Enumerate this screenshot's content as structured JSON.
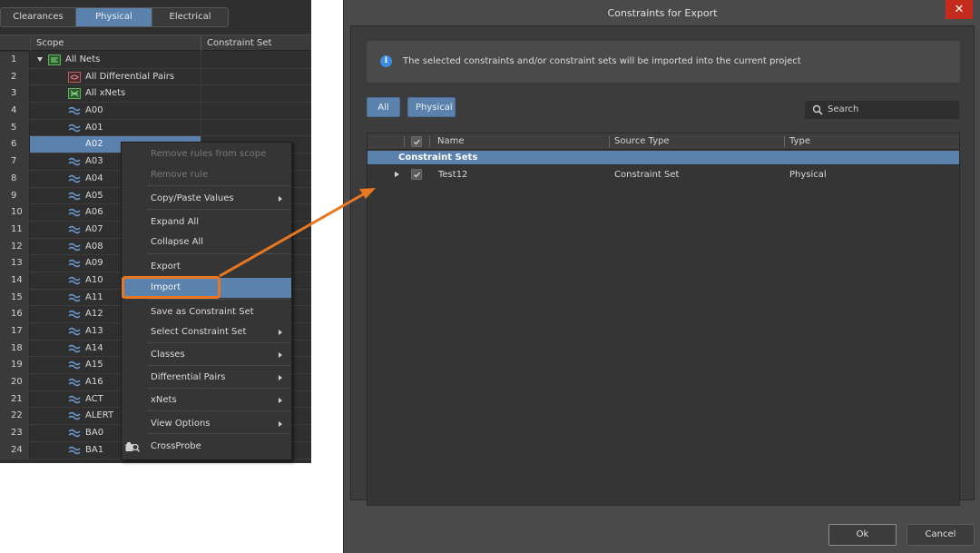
{
  "left_panel": {
    "tabs": [
      {
        "label": "Clearances",
        "active": false
      },
      {
        "label": "Physical",
        "active": true
      },
      {
        "label": "Electrical",
        "active": false
      }
    ],
    "columns": {
      "scope": "Scope",
      "constraint_set": "Constraint Set"
    },
    "rows": [
      {
        "num": "1",
        "label": "All Nets",
        "icon": "all-nets-icon",
        "level": 0,
        "expanded": true
      },
      {
        "num": "2",
        "label": "All Differential Pairs",
        "icon": "differential-pairs-icon",
        "level": 1
      },
      {
        "num": "3",
        "label": "All xNets",
        "icon": "xnets-icon",
        "level": 1
      },
      {
        "num": "4",
        "label": "A00",
        "icon": "net-icon",
        "level": 1
      },
      {
        "num": "5",
        "label": "A01",
        "icon": "net-icon",
        "level": 1
      },
      {
        "num": "6",
        "label": "A02",
        "icon": "net-icon",
        "level": 1,
        "selected": true
      },
      {
        "num": "7",
        "label": "A03",
        "icon": "net-icon",
        "level": 1
      },
      {
        "num": "8",
        "label": "A04",
        "icon": "net-icon",
        "level": 1
      },
      {
        "num": "9",
        "label": "A05",
        "icon": "net-icon",
        "level": 1
      },
      {
        "num": "10",
        "label": "A06",
        "icon": "net-icon",
        "level": 1
      },
      {
        "num": "11",
        "label": "A07",
        "icon": "net-icon",
        "level": 1
      },
      {
        "num": "12",
        "label": "A08",
        "icon": "net-icon",
        "level": 1
      },
      {
        "num": "13",
        "label": "A09",
        "icon": "net-icon",
        "level": 1
      },
      {
        "num": "14",
        "label": "A10",
        "icon": "net-icon",
        "level": 1
      },
      {
        "num": "15",
        "label": "A11",
        "icon": "net-icon",
        "level": 1
      },
      {
        "num": "16",
        "label": "A12",
        "icon": "net-icon",
        "level": 1
      },
      {
        "num": "17",
        "label": "A13",
        "icon": "net-icon",
        "level": 1
      },
      {
        "num": "18",
        "label": "A14",
        "icon": "net-icon",
        "level": 1
      },
      {
        "num": "19",
        "label": "A15",
        "icon": "net-icon",
        "level": 1
      },
      {
        "num": "20",
        "label": "A16",
        "icon": "net-icon",
        "level": 1
      },
      {
        "num": "21",
        "label": "ACT",
        "icon": "net-icon",
        "level": 1
      },
      {
        "num": "22",
        "label": "ALERT",
        "icon": "net-icon",
        "level": 1
      },
      {
        "num": "23",
        "label": "BA0",
        "icon": "net-icon",
        "level": 1
      },
      {
        "num": "24",
        "label": "BA1",
        "icon": "net-icon",
        "level": 1
      }
    ]
  },
  "context_menu": {
    "items": [
      {
        "label": "Remove rules from scope",
        "disabled": true
      },
      {
        "label": "Remove rule",
        "disabled": true
      },
      {
        "label": "Copy/Paste Values",
        "submenu": true
      },
      {
        "label": "Expand All"
      },
      {
        "label": "Collapse All"
      },
      {
        "label": "Export"
      },
      {
        "label": "Import",
        "highlighted": true
      },
      {
        "label": "Save as Constraint Set"
      },
      {
        "label": "Select Constraint Set",
        "submenu": true
      },
      {
        "label": "Classes",
        "submenu": true
      },
      {
        "label": "Differential Pairs",
        "submenu": true
      },
      {
        "label": "xNets",
        "submenu": true
      },
      {
        "label": "View Options",
        "submenu": true
      },
      {
        "label": "CrossProbe",
        "icon": "crossprobe-icon"
      }
    ]
  },
  "callout": {
    "color": "#e87722"
  },
  "dialog": {
    "title": "Constraints for Export",
    "close_label": "✕",
    "info_text": "The selected constraints and/or constraint sets will be imported into the current project",
    "filters": [
      "All",
      "Physical"
    ],
    "search_placeholder": "Search",
    "columns": {
      "name": "Name",
      "source_type": "Source Type",
      "type": "Type"
    },
    "groups": [
      {
        "label": "Constraint Sets",
        "rows": [
          {
            "name": "Test12",
            "source_type": "Constraint Set",
            "type": "Physical",
            "checked": true
          }
        ]
      }
    ],
    "ok_label": "Ok",
    "cancel_label": "Cancel"
  },
  "colors": {
    "accent": "#5b82ad",
    "close_red": "#c42b1c",
    "info_blue": "#3d8ee0",
    "callout_orange": "#e87722"
  }
}
